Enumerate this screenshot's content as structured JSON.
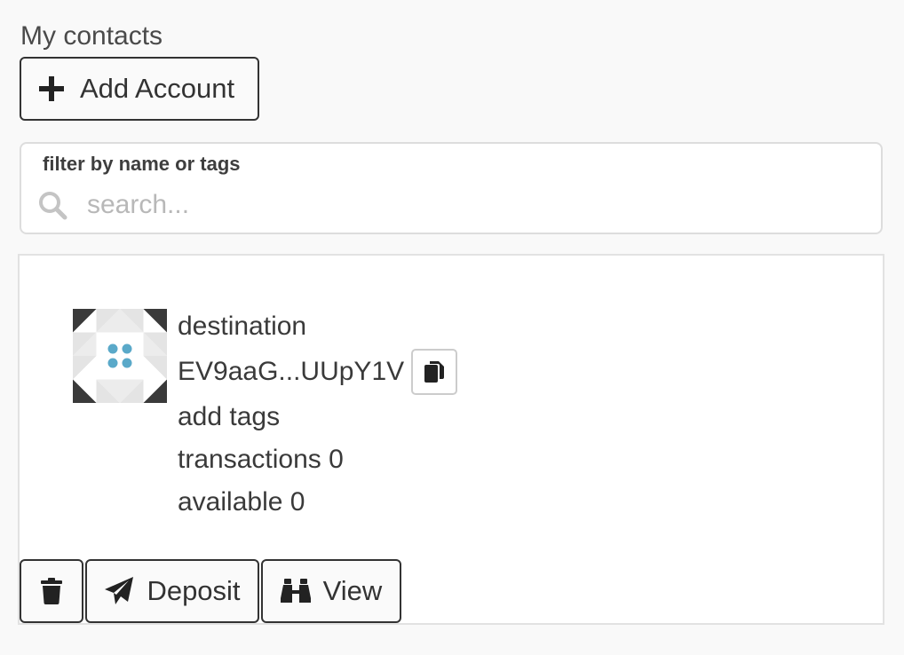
{
  "header": {
    "title": "My contacts"
  },
  "toolbar": {
    "add_account_label": "Add Account",
    "add_icon": "plus-icon"
  },
  "filter": {
    "label": "filter by name or tags",
    "placeholder": "search...",
    "value": "",
    "icon": "search-icon"
  },
  "contact": {
    "name": "destination",
    "address": "EV9aaG...UUpY1V",
    "tags": "add tags",
    "transactions": "transactions 0",
    "available": "available 0",
    "copy_icon": "copy-icon",
    "identicon_accent": "#5aa9c9"
  },
  "actions": {
    "delete_icon": "trash-icon",
    "deposit_label": "Deposit",
    "deposit_icon": "paper-plane-icon",
    "view_label": "View",
    "view_icon": "binoculars-icon"
  },
  "colors": {
    "border_dark": "#333333",
    "text": "#3a3a3a",
    "placeholder": "#b8b8b8"
  }
}
